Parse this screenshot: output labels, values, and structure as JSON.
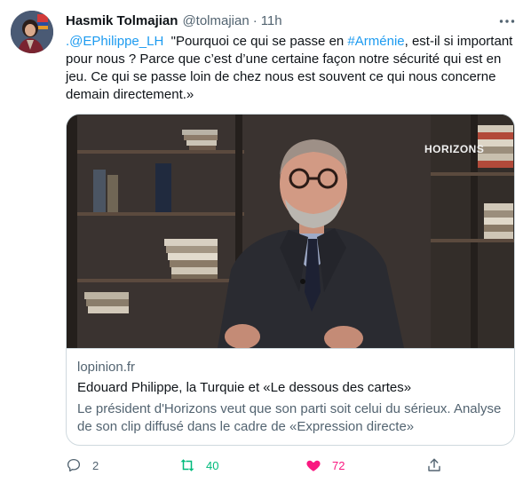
{
  "tweet": {
    "author_name": "Hasmik Tolmajian",
    "author_handle": "@tolmajian",
    "separator": "·",
    "time": "11h",
    "text_parts": {
      "mention": ".@EPhilippe_LH",
      "part1": "  \"Pourquoi ce qui se passe en ",
      "hashtag": "#Arménie",
      "part2": ", est-il si important pour nous ? Parce que c’est d’une certaine façon notre sécurité qui est en jeu. Ce qui se passe loin de chez nous est souvent ce qui nous concerne demain directement.»"
    }
  },
  "card": {
    "image_watermark": "HORIZONS",
    "domain": "lopinion.fr",
    "title": "Edouard Philippe, la Turquie et «Le dessous des cartes»",
    "description": "Le président d'Horizons veut que son parti soit celui du sérieux. Analyse de son clip diffusé dans le cadre de «Expression directe»"
  },
  "actions": {
    "reply_count": "2",
    "retweet_count": "40",
    "like_count": "72"
  },
  "icons": {
    "more": "more-icon",
    "reply": "reply-icon",
    "retweet": "retweet-icon",
    "like": "heart-icon",
    "share": "share-icon"
  },
  "colors": {
    "link": "#1d9bf0",
    "retweet_active": "#00ba7c",
    "like_active": "#f91880",
    "secondary_text": "#536471"
  }
}
